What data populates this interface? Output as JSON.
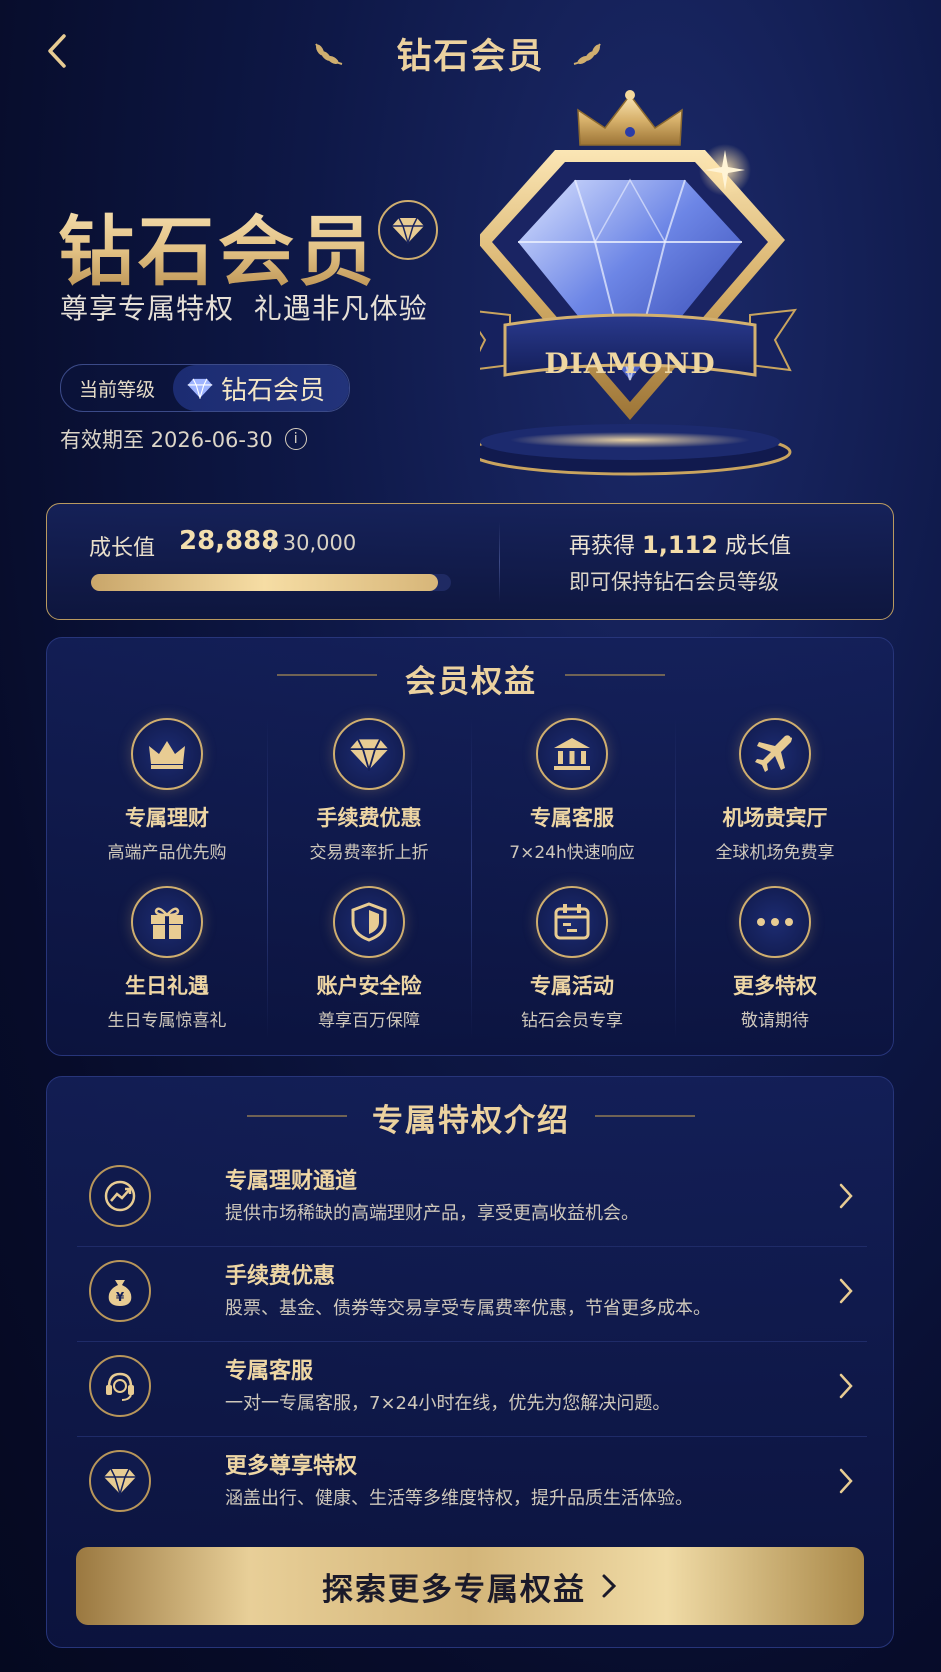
{
  "header": {
    "title": "钻石会员"
  },
  "hero": {
    "title": "钻石会员",
    "subtitle": "尊享专属特权  礼遇非凡体验",
    "level_label": "当前等级",
    "level_value": "钻石会员",
    "expiry": "有效期至 2026-06-30",
    "emblem_ribbon": "DIAMOND"
  },
  "growth": {
    "label": "成长值",
    "current": "28,888",
    "total": "/ 30,000",
    "progress_fraction": 0.963,
    "need_prefix": "再获得",
    "need_value": "1,112",
    "need_suffix": "成长值",
    "hint": "即可保持钻石会员等级"
  },
  "benefits": {
    "title": "会员权益",
    "items": [
      {
        "name": "专属理财",
        "desc": "高端产品优先购",
        "icon": "crown-icon"
      },
      {
        "name": "手续费优惠",
        "desc": "交易费率折上折",
        "icon": "diamond-icon"
      },
      {
        "name": "专属客服",
        "desc": "7×24h快速响应",
        "icon": "bank-icon"
      },
      {
        "name": "机场贵宾厅",
        "desc": "全球机场免费享",
        "icon": "airplane-icon"
      },
      {
        "name": "生日礼遇",
        "desc": "生日专属惊喜礼",
        "icon": "gift-icon"
      },
      {
        "name": "账户安全险",
        "desc": "尊享百万保障",
        "icon": "shield-icon"
      },
      {
        "name": "专属活动",
        "desc": "钻石会员专享",
        "icon": "calendar-icon"
      },
      {
        "name": "更多特权",
        "desc": "敬请期待",
        "icon": "more-icon"
      }
    ]
  },
  "intro": {
    "title": "专属特权介绍",
    "items": [
      {
        "name": "专属理财通道",
        "desc": "提供市场稀缺的高端理财产品，享受更高收益机会。",
        "icon": "chart-trend-icon"
      },
      {
        "name": "手续费优惠",
        "desc": "股票、基金、债券等交易享受专属费率优惠，节省更多成本。",
        "icon": "money-bag-icon"
      },
      {
        "name": "专属客服",
        "desc": "一对一专属客服，7×24小时在线，优先为您解决问题。",
        "icon": "headset-icon"
      },
      {
        "name": "更多尊享特权",
        "desc": "涵盖出行、健康、生活等多维度特权，提升品质生活体验。",
        "icon": "diamond-icon"
      }
    ]
  },
  "cta": {
    "label": "探索更多专属权益"
  },
  "colors": {
    "gold": "#e8cc93",
    "navy": "#0e1847",
    "accent_blue": "#2a3b8f"
  }
}
